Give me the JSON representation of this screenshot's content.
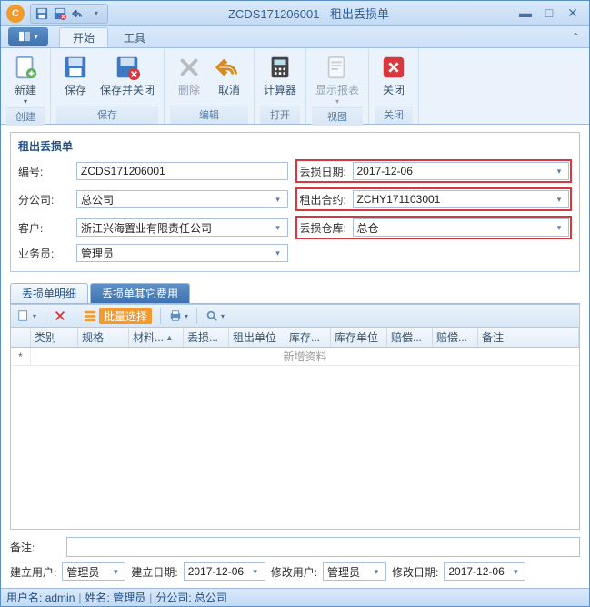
{
  "window": {
    "title": "ZCDS171206001 - 租出丢损单"
  },
  "ribbon_tabs": {
    "start": "开始",
    "tools": "工具"
  },
  "ribbon": {
    "group_create": "创建",
    "group_save": "保存",
    "group_edit": "编辑",
    "group_open": "打开",
    "group_view": "视图",
    "group_close": "关闭",
    "btn_new": "新建",
    "btn_save": "保存",
    "btn_save_close": "保存并关闭",
    "btn_delete": "删除",
    "btn_cancel": "取消",
    "btn_calculator": "计算器",
    "btn_report": "显示报表",
    "btn_close": "关闭"
  },
  "form": {
    "title": "租出丢损单",
    "lbl_no": "编号:",
    "val_no": "ZCDS171206001",
    "lbl_date": "丢损日期:",
    "val_date": "2017-12-06",
    "lbl_branch": "分公司:",
    "val_branch": "总公司",
    "lbl_contract": "租出合约:",
    "val_contract": "ZCHY171103001",
    "lbl_customer": "客户:",
    "val_customer": "浙江兴海置业有限责任公司",
    "lbl_warehouse": "丢损仓库:",
    "val_warehouse": "总仓",
    "lbl_operator": "业务员:",
    "val_operator": "管理员"
  },
  "tabs": {
    "detail": "丢损单明细",
    "other": "丢损单其它费用"
  },
  "toolbar": {
    "batch": "批量选择"
  },
  "grid": {
    "cols": [
      "类别",
      "规格",
      "材料...",
      "丢损...",
      "租出单位",
      "库存...",
      "库存单位",
      "赔偿...",
      "赔偿...",
      "备注"
    ],
    "addrow_text": "新增资料",
    "addrow_star": "*"
  },
  "footer": {
    "lbl_remark": "备注:",
    "lbl_create_user": "建立用户:",
    "val_create_user": "管理员",
    "lbl_create_date": "建立日期:",
    "val_create_date": "2017-12-06",
    "lbl_modify_user": "修改用户:",
    "val_modify_user": "管理员",
    "lbl_modify_date": "修改日期:",
    "val_modify_date": "2017-12-06"
  },
  "status": {
    "user_label": "用户名:",
    "user_value": "admin",
    "name_label": "姓名:",
    "name_value": "管理员",
    "branch_label": "分公司:",
    "branch_value": "总公司"
  }
}
